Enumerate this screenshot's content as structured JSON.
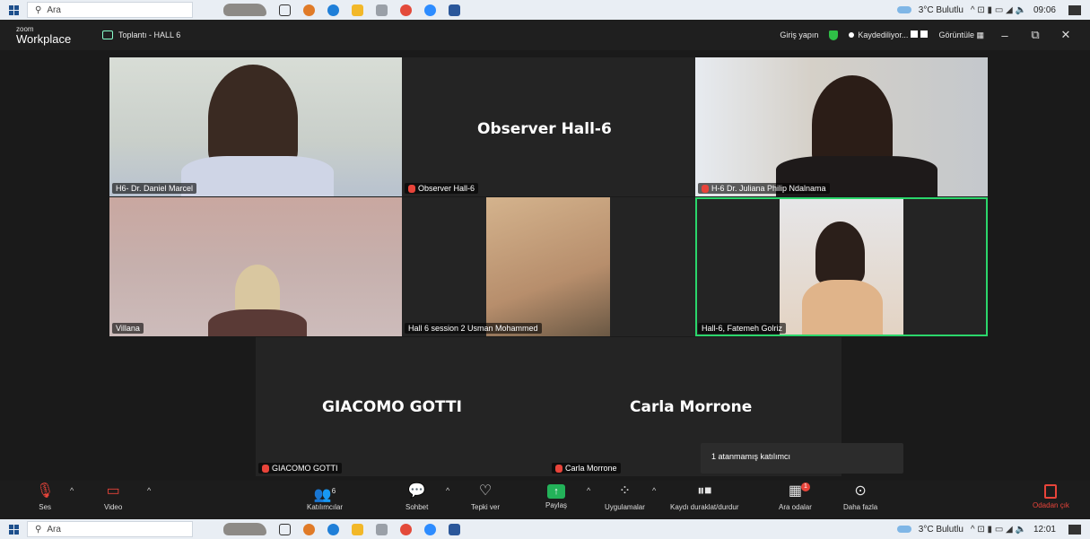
{
  "taskbar_top": {
    "search_placeholder": "Ara",
    "weather": "3°C Bulutlu",
    "tray": "^ ⊡ ▮ ▭ ◢ 🔈",
    "time": "09:06"
  },
  "taskbar_bottom": {
    "search_placeholder": "Ara",
    "weather": "3°C Bulutlu",
    "tray": "^ ⊡ ▮ ▭ ◢ 🔈",
    "time": "12:01"
  },
  "app": {
    "brand_small": "zoom",
    "brand_big": "Workplace",
    "meeting_title": "Toplantı - HALL 6",
    "sign_in": "Giriş yapın",
    "recording": "Kaydediliyor...",
    "view": "Görüntüle",
    "view_icon": "▦"
  },
  "participants": {
    "daniel": "H6- Dr. Daniel Marcel",
    "observer_center": "Observer Hall-6",
    "observer_tag": "Observer Hall-6",
    "juliana": "H-6 Dr. Juliana Philip Ndalnama",
    "villana": "Villana",
    "usman": "Hall 6 session 2 Usman Mohammed",
    "fatemeh": "Hall-6, Fatemeh Golriz",
    "giacomo_center": "GIACOMO GOTTI",
    "giacomo_tag": "GIACOMO GOTTI",
    "carla_center": "Carla Morrone",
    "carla_tag": "Carla Morrone"
  },
  "tooltip": "1 atanmamış katılımcı",
  "toolbar": {
    "audio": "Ses",
    "video": "Video",
    "participants": "Katılımcılar",
    "participants_count": "6",
    "chat": "Sohbet",
    "react": "Tepki ver",
    "share": "Paylaş",
    "apps": "Uygulamalar",
    "record": "Kaydı duraklat/durdur",
    "breakout": "Ara odalar",
    "breakout_badge": "1",
    "more": "Daha fazla",
    "leave": "Odadan çık"
  },
  "colors": {
    "active_speaker": "#2bd66b",
    "share": "#23b259",
    "alert": "#e8443a"
  }
}
